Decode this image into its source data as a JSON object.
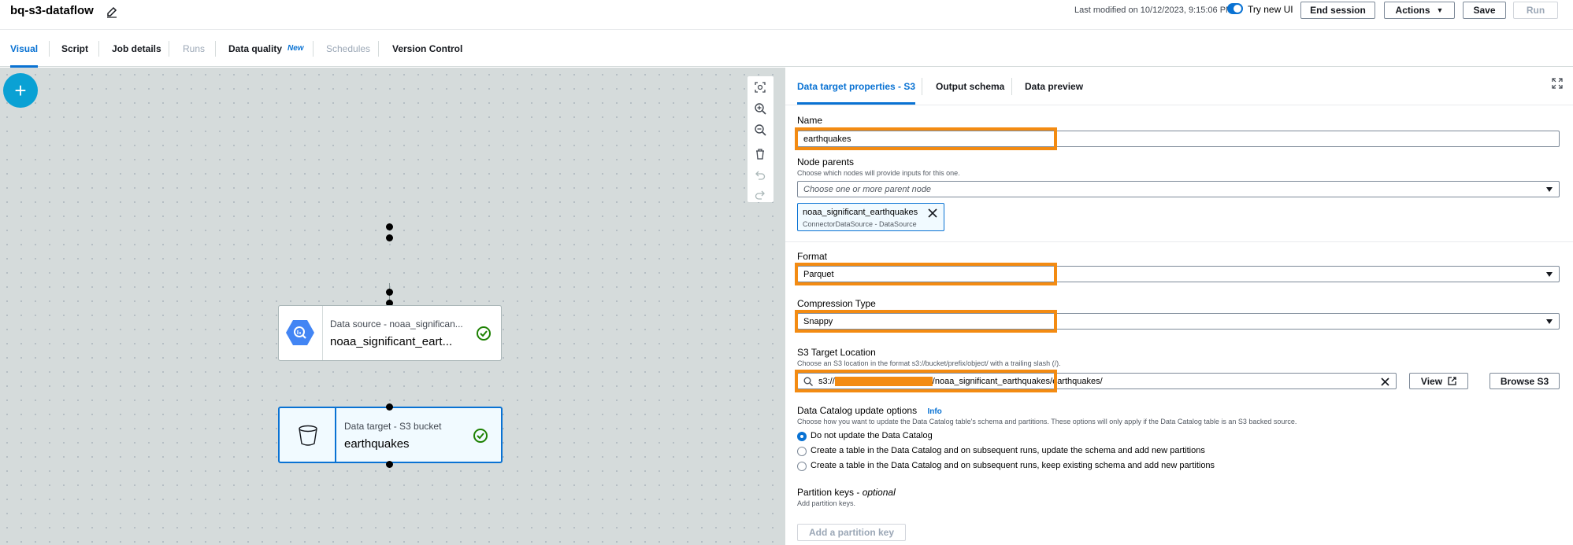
{
  "header": {
    "job_name": "bq-s3-dataflow",
    "last_modified": "Last modified on 10/12/2023, 9:15:06 PM",
    "try_new_ui": "Try new UI",
    "end_session": "End session",
    "actions": "Actions",
    "save": "Save",
    "run": "Run"
  },
  "tabs": {
    "visual": "Visual",
    "script": "Script",
    "job_details": "Job details",
    "runs": "Runs",
    "data_quality": "Data quality",
    "data_quality_badge": "New",
    "schedules": "Schedules",
    "version_control": "Version Control"
  },
  "canvas": {
    "add_symbol": "+",
    "source_node": {
      "label": "Data source - noaa_significan...",
      "title": "noaa_significant_eart..."
    },
    "target_node": {
      "label": "Data target - S3 bucket",
      "title": "earthquakes"
    }
  },
  "panel": {
    "tabs": {
      "properties": "Data target properties - S3",
      "output_schema": "Output schema",
      "data_preview": "Data preview"
    },
    "name_label": "Name",
    "name_value": "earthquakes",
    "node_parents_label": "Node parents",
    "node_parents_desc": "Choose which nodes will provide inputs for this one.",
    "node_parents_placeholder": "Choose one or more parent node",
    "parent_token": {
      "name": "noaa_significant_earthquakes",
      "type": "ConnectorDataSource - DataSource"
    },
    "format_label": "Format",
    "format_value": "Parquet",
    "compression_label": "Compression Type",
    "compression_value": "Snappy",
    "s3_label": "S3 Target Location",
    "s3_desc": "Choose an S3 location in the format s3://bucket/prefix/object/ with a trailing slash (/).",
    "s3_prefix": "s3://",
    "s3_suffix": "/noaa_significant_earthquakes/earthquakes/",
    "view": "View",
    "browse_s3": "Browse S3",
    "catalog_label": "Data Catalog update options",
    "catalog_info": "Info",
    "catalog_desc": "Choose how you want to update the Data Catalog table's schema and partitions. These options will only apply if the Data Catalog table is an S3 backed source.",
    "catalog_options": [
      "Do not update the Data Catalog",
      "Create a table in the Data Catalog and on subsequent runs, update the schema and add new partitions",
      "Create a table in the Data Catalog and on subsequent runs, keep existing schema and add new partitions"
    ],
    "partition_label": "Partition keys - ",
    "partition_optional": "optional",
    "partition_desc": "Add partition keys.",
    "add_partition": "Add a partition key"
  },
  "colors": {
    "accent": "#0972d3",
    "highlight": "#f38b12",
    "success": "#1d8102"
  }
}
